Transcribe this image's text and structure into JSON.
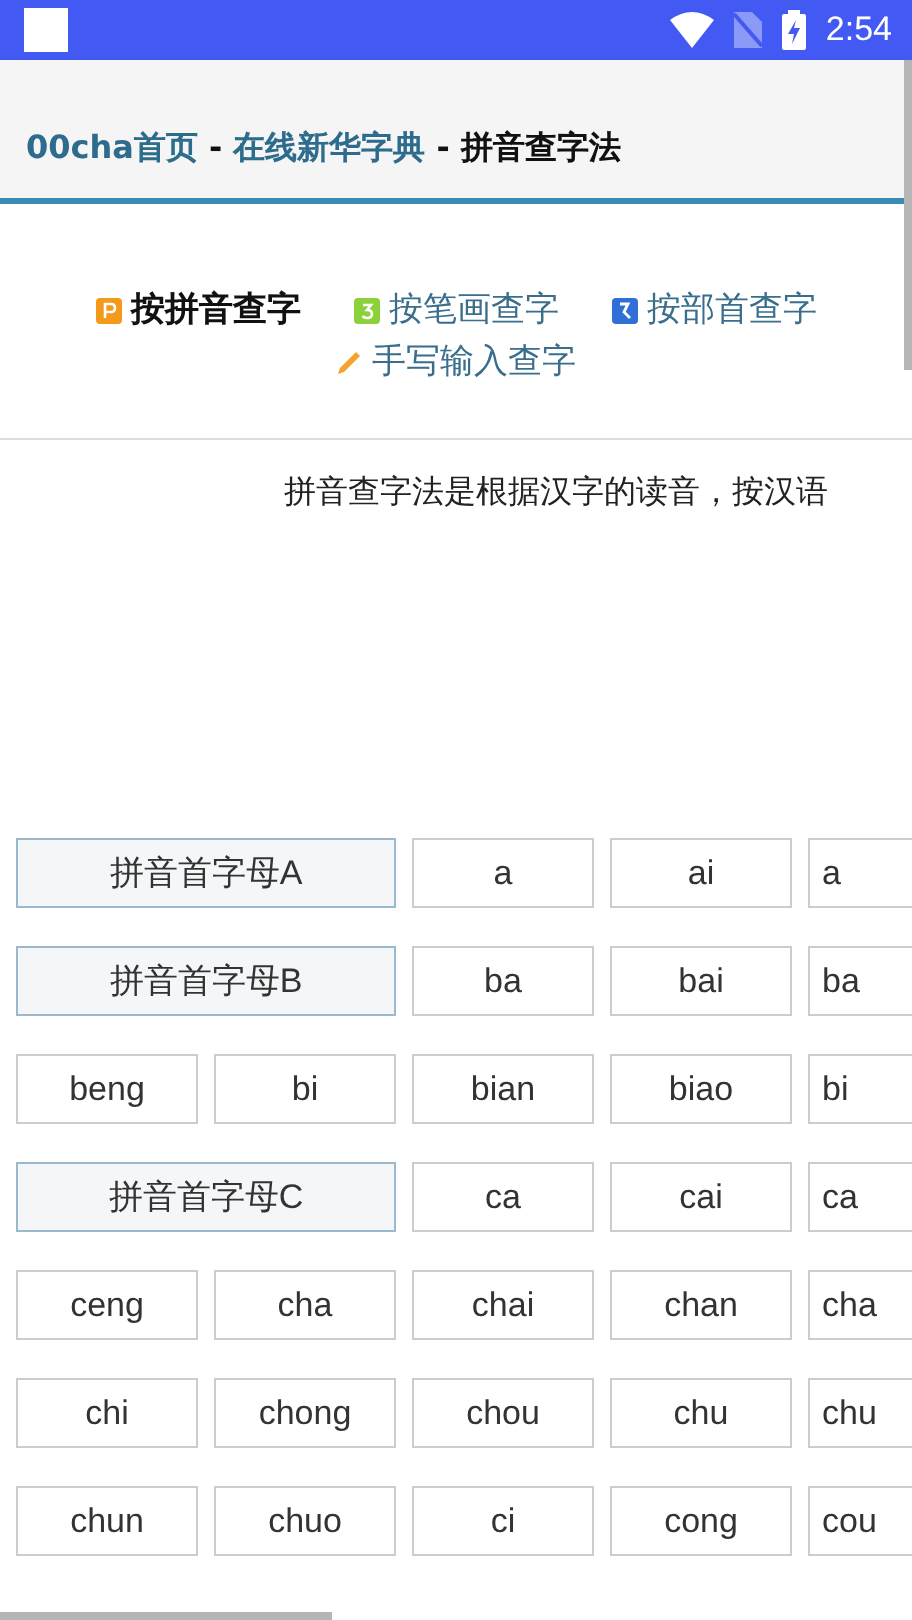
{
  "status_bar": {
    "time": "2:54"
  },
  "breadcrumb": [
    {
      "kind": "link",
      "text": "00cha首页"
    },
    {
      "kind": "separator",
      "text": " - "
    },
    {
      "kind": "link",
      "text": "在线新华字典"
    },
    {
      "kind": "separator",
      "text": " - "
    },
    {
      "kind": "current",
      "text": "拼音查字法"
    }
  ],
  "tabs": [
    {
      "label": "按拼音查字",
      "selected": true
    },
    {
      "label": "按笔画查字",
      "selected": false
    },
    {
      "label": "按部首查字",
      "selected": false
    },
    {
      "label": "手写输入查字",
      "selected": false
    }
  ],
  "intro": "拼音查字法是根据汉字的读音，按汉语",
  "rows": [
    [
      {
        "kind": "header",
        "text": "拼音首字母A"
      },
      {
        "kind": "syllable",
        "text": "a"
      },
      {
        "kind": "syllable",
        "text": "ai"
      },
      {
        "kind": "syllable",
        "text": "a"
      }
    ],
    [
      {
        "kind": "header",
        "text": "拼音首字母B"
      },
      {
        "kind": "syllable",
        "text": "ba"
      },
      {
        "kind": "syllable",
        "text": "bai"
      },
      {
        "kind": "syllable",
        "text": "ba"
      }
    ],
    [
      {
        "kind": "syllable",
        "text": "beng"
      },
      {
        "kind": "syllable",
        "text": "bi"
      },
      {
        "kind": "syllable",
        "text": "bian"
      },
      {
        "kind": "syllable",
        "text": "biao"
      },
      {
        "kind": "syllable",
        "text": "bi"
      }
    ],
    [
      {
        "kind": "header",
        "text": "拼音首字母C"
      },
      {
        "kind": "syllable",
        "text": "ca"
      },
      {
        "kind": "syllable",
        "text": "cai"
      },
      {
        "kind": "syllable",
        "text": "ca"
      }
    ],
    [
      {
        "kind": "syllable",
        "text": "ceng"
      },
      {
        "kind": "syllable",
        "text": "cha"
      },
      {
        "kind": "syllable",
        "text": "chai"
      },
      {
        "kind": "syllable",
        "text": "chan"
      },
      {
        "kind": "syllable",
        "text": "cha"
      }
    ],
    [
      {
        "kind": "syllable",
        "text": "chi"
      },
      {
        "kind": "syllable",
        "text": "chong"
      },
      {
        "kind": "syllable",
        "text": "chou"
      },
      {
        "kind": "syllable",
        "text": "chu"
      },
      {
        "kind": "syllable",
        "text": "chu"
      }
    ],
    [
      {
        "kind": "syllable",
        "text": "chun"
      },
      {
        "kind": "syllable",
        "text": "chuo"
      },
      {
        "kind": "syllable",
        "text": "ci"
      },
      {
        "kind": "syllable",
        "text": "cong"
      },
      {
        "kind": "syllable",
        "text": "cou"
      }
    ]
  ]
}
